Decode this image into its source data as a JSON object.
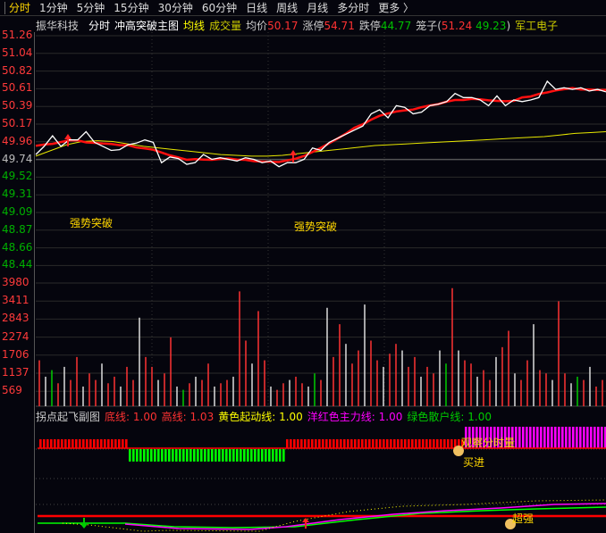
{
  "tabs": [
    "分时",
    "1分钟",
    "5分钟",
    "15分钟",
    "30分钟",
    "60分钟",
    "日线",
    "周线",
    "月线",
    "多分时",
    "更多 〉"
  ],
  "info": {
    "name": "振华科技",
    "period": "分时",
    "main": "冲高突破主图",
    "avg_line": "均线",
    "volume": "成交量",
    "avg_label": "均价",
    "avg_value": "50.17",
    "limit_up_label": "涨停",
    "limit_up": "54.71",
    "limit_down_label": "跌停",
    "limit_down": "44.77",
    "cage_label": "笼子(",
    "cage_high": "51.24",
    "cage_low": "49.23",
    "cage_close": ")",
    "sector": "军工电子"
  },
  "price_axis": [
    "51.26",
    "51.04",
    "50.82",
    "50.61",
    "50.39",
    "50.17",
    "49.96",
    "49.74",
    "49.52",
    "49.31",
    "49.09",
    "48.87",
    "48.66",
    "48.44"
  ],
  "volume_axis": [
    "3980",
    "3411",
    "2843",
    "2274",
    "1706",
    "1137",
    "569"
  ],
  "signals": [
    "强势突破",
    "强势突破"
  ],
  "sub": {
    "title": "拐点起飞副图",
    "low_label": "底线:",
    "low": "1.00",
    "high_label": "高线:",
    "high": "1.03",
    "yellow_label": "黄色起动线:",
    "yellow": "1.00",
    "magenta_label": "洋红色主力线:",
    "magenta": "1.00",
    "green_label": "绿色散户线:",
    "green": "1.00",
    "watch": "观察分时量",
    "buy": "买进",
    "strong": "超强"
  },
  "chart_data": {
    "type": "line",
    "prev_close": 49.74,
    "ylim": [
      48.44,
      51.26
    ],
    "price": [
      49.8,
      49.9,
      50.03,
      49.9,
      49.98,
      49.98,
      50.08,
      49.95,
      49.9,
      49.85,
      49.86,
      49.92,
      49.94,
      49.98,
      49.95,
      49.7,
      49.77,
      49.75,
      49.68,
      49.7,
      49.8,
      49.74,
      49.76,
      49.74,
      49.72,
      49.76,
      49.74,
      49.7,
      49.72,
      49.65,
      49.7,
      49.7,
      49.74,
      49.88,
      49.85,
      49.95,
      50.0,
      50.05,
      50.1,
      50.15,
      50.3,
      50.35,
      50.25,
      50.4,
      50.38,
      50.3,
      50.32,
      50.4,
      50.42,
      50.45,
      50.55,
      50.5,
      50.5,
      50.47,
      50.4,
      50.52,
      50.4,
      50.47,
      50.45,
      50.47,
      50.5,
      50.7,
      50.6,
      50.62,
      50.6,
      50.62,
      50.58,
      50.6,
      50.57
    ],
    "avg": [
      49.78,
      49.85,
      49.92,
      49.96,
      49.97,
      49.96,
      49.93,
      49.9,
      49.88,
      49.86,
      49.84,
      49.82,
      49.8,
      49.79,
      49.78,
      49.78,
      49.79,
      49.81,
      49.83,
      49.85,
      49.87,
      49.89,
      49.91,
      49.92,
      49.93,
      49.94,
      49.95,
      49.96,
      49.97,
      49.98,
      49.99,
      50.0,
      50.01,
      50.02,
      50.04,
      50.06,
      50.07,
      50.08
    ],
    "volume": [
      1400,
      900,
      1100,
      700,
      1200,
      800,
      1500,
      600,
      1000,
      800,
      1300,
      700,
      900,
      600,
      1200,
      800,
      2700,
      1500,
      1200,
      800,
      1000,
      2100,
      600,
      500,
      700,
      900,
      800,
      1300,
      600,
      700,
      800,
      900,
      3500,
      2000,
      1300,
      2900,
      1400,
      600,
      500,
      700,
      800,
      900,
      700,
      600,
      1000,
      800,
      3000,
      1500,
      2500,
      1900,
      1300,
      1700,
      3100,
      2000,
      1400,
      1200,
      1600,
      1900,
      1700,
      1200,
      1500,
      900,
      1200,
      1000,
      1700,
      1300,
      3600,
      1700,
      1400,
      1300,
      900,
      1100,
      800,
      1500,
      1800,
      2300,
      1000,
      800,
      1400,
      2500,
      1100,
      1000,
      800,
      3200,
      1000,
      700,
      900,
      800,
      1200,
      600,
      800
    ],
    "vol_max": 4300
  }
}
